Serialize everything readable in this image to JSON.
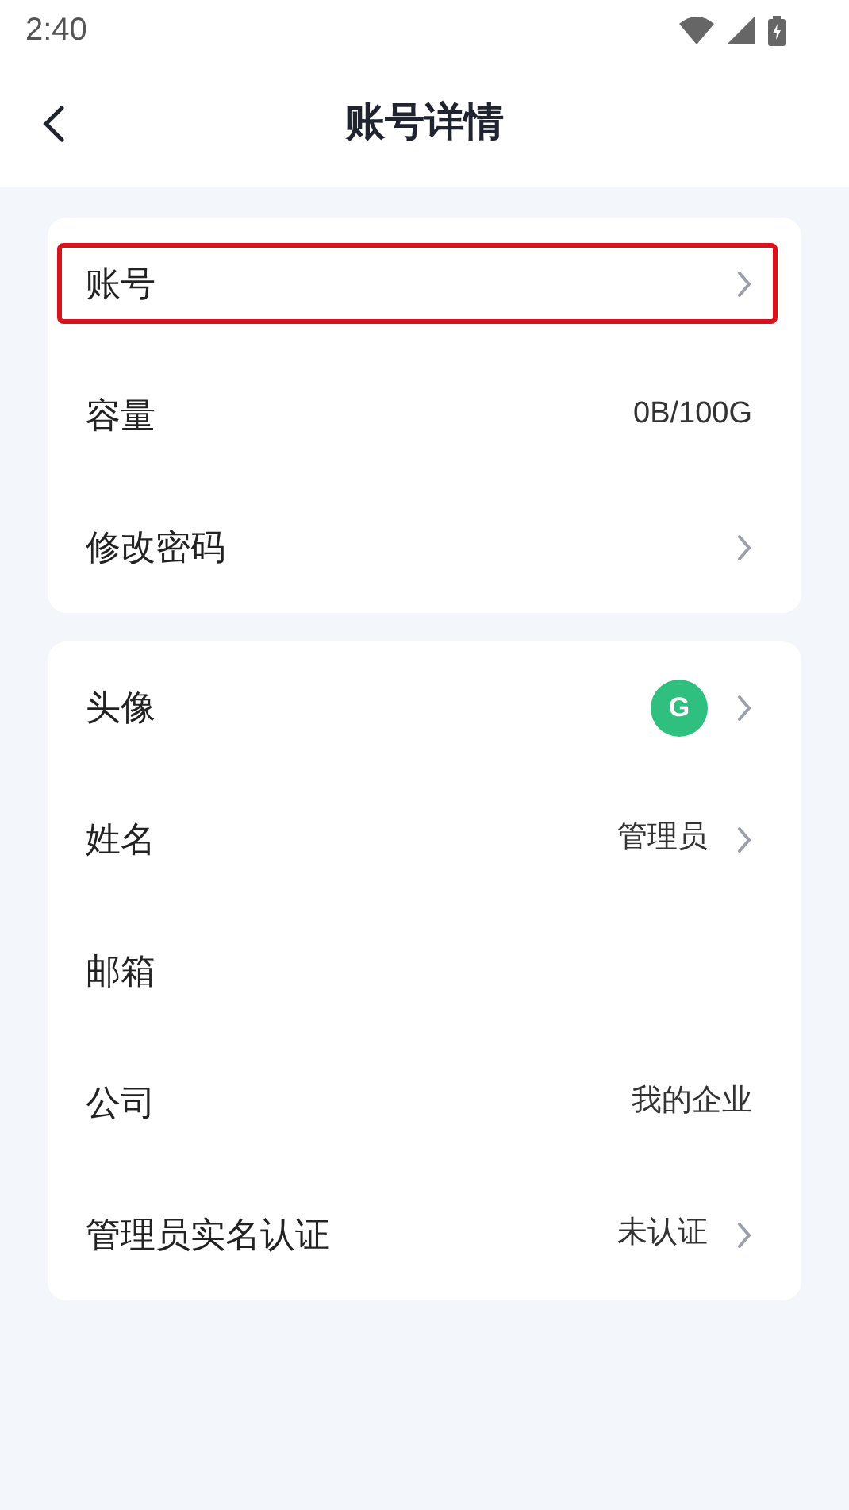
{
  "status_bar": {
    "time": "2:40"
  },
  "header": {
    "title": "账号详情"
  },
  "groups": [
    {
      "rows": [
        {
          "label": "账号",
          "chevron": true,
          "highlighted": true
        },
        {
          "label": "容量",
          "value": "0B/100G",
          "chevron": false,
          "highlighted": false
        },
        {
          "label": "修改密码",
          "chevron": true,
          "highlighted": false
        }
      ]
    },
    {
      "rows": [
        {
          "label": "头像",
          "avatar": "G",
          "chevron": true,
          "highlighted": false
        },
        {
          "label": "姓名",
          "value": "管理员",
          "chevron": true,
          "highlighted": false
        },
        {
          "label": "邮箱",
          "chevron": false,
          "highlighted": false
        },
        {
          "label": "公司",
          "value": "我的企业",
          "chevron": false,
          "highlighted": false
        },
        {
          "label": "管理员实名认证",
          "value": "未认证",
          "chevron": true,
          "highlighted": false
        }
      ]
    }
  ]
}
